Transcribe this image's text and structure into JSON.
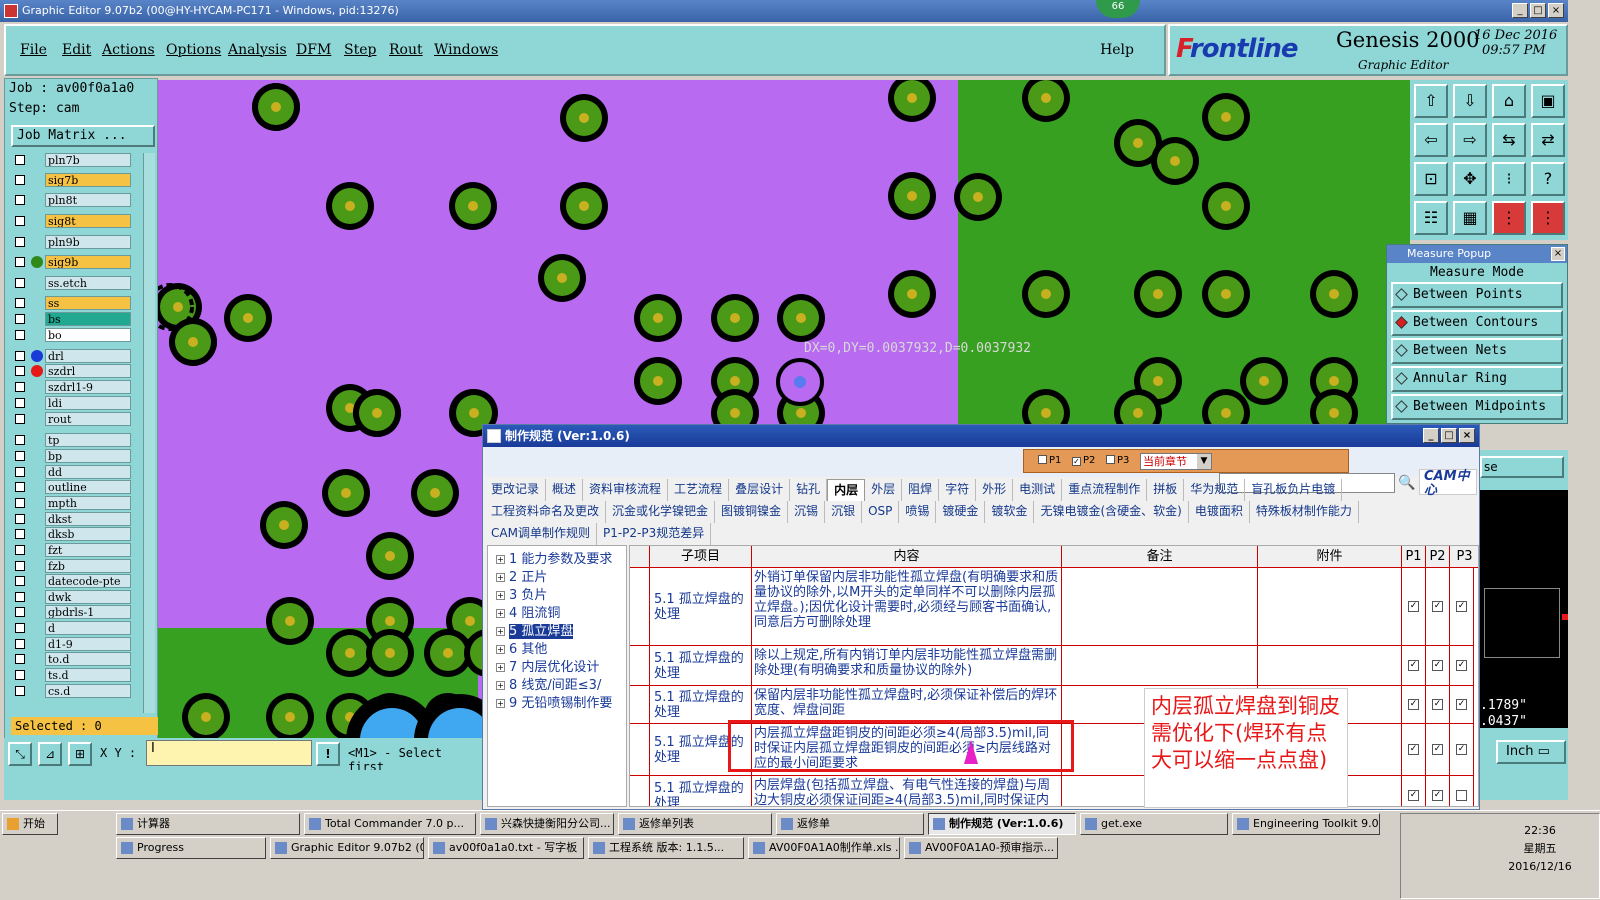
{
  "window": {
    "title": "Graphic Editor 9.07b2 (00@HY-HYCAM-PC171 - Windows, pid:13276)",
    "badge": "66"
  },
  "menu": {
    "items": [
      "File",
      "Edit",
      "Actions",
      "Options",
      "Analysis",
      "DFM",
      "Step",
      "Rout",
      "Windows"
    ],
    "help": "Help"
  },
  "logo": {
    "brand_f": "F",
    "brand_rest": "rontline",
    "product": "Genesis 2000",
    "subtitle": "Graphic Editor",
    "date": "16 Dec 2016",
    "time": "09:57 PM"
  },
  "job": {
    "job_line": "Job : av00f0a1a0",
    "step_line": "Step: cam",
    "matrix_btn": "Job Matrix ..."
  },
  "layers": [
    {
      "name": "pln7b",
      "style": "lightblue",
      "dot": ""
    },
    {
      "name": "sig7b",
      "style": "orange",
      "dot": ""
    },
    {
      "name": "pln8t",
      "style": "lightblue",
      "dot": ""
    },
    {
      "name": "sig8t",
      "style": "orange",
      "dot": ""
    },
    {
      "name": "pln9b",
      "style": "lightblue",
      "dot": ""
    },
    {
      "name": "sig9b",
      "style": "orange",
      "dot": "#2f8a1a"
    },
    {
      "name": "ss.etch",
      "style": "lightblue",
      "dot": ""
    },
    {
      "name": "ss",
      "style": "orange",
      "dot": ""
    },
    {
      "name": "bs",
      "style": "teal",
      "dot": ""
    },
    {
      "name": "bo",
      "style": "white",
      "dot": ""
    },
    {
      "name": "drl",
      "style": "lightblue",
      "dot": "#1a3ad8"
    },
    {
      "name": "szdrl",
      "style": "lightblue",
      "dot": "#e81818"
    },
    {
      "name": "szdrl1-9",
      "style": "lightblue",
      "dot": ""
    },
    {
      "name": "ldi",
      "style": "lightblue",
      "dot": ""
    },
    {
      "name": "rout",
      "style": "lightblue",
      "dot": ""
    },
    {
      "name": "tp",
      "style": "lightblue",
      "dot": ""
    },
    {
      "name": "bp",
      "style": "lightblue",
      "dot": ""
    },
    {
      "name": "dd",
      "style": "lightblue",
      "dot": ""
    },
    {
      "name": "outline",
      "style": "lightblue",
      "dot": ""
    },
    {
      "name": "mpth",
      "style": "lightblue",
      "dot": ""
    },
    {
      "name": "dkst",
      "style": "lightblue",
      "dot": ""
    },
    {
      "name": "dksb",
      "style": "lightblue",
      "dot": ""
    },
    {
      "name": "fzt",
      "style": "lightblue",
      "dot": ""
    },
    {
      "name": "fzb",
      "style": "lightblue",
      "dot": ""
    },
    {
      "name": "datecode-pte",
      "style": "lightblue",
      "dot": ""
    },
    {
      "name": "dwk",
      "style": "lightblue",
      "dot": ""
    },
    {
      "name": "gbdrls-1",
      "style": "lightblue",
      "dot": ""
    },
    {
      "name": "d",
      "style": "lightblue",
      "dot": ""
    },
    {
      "name": "d1-9",
      "style": "lightblue",
      "dot": ""
    },
    {
      "name": "to.d",
      "style": "lightblue",
      "dot": ""
    },
    {
      "name": "ts.d",
      "style": "lightblue",
      "dot": ""
    },
    {
      "name": "cs.d",
      "style": "lightblue",
      "dot": ""
    }
  ],
  "selected": "Selected : 0",
  "xy_label": "X Y :",
  "xy_value": "I",
  "prompt": "<M1> - Select first",
  "measure_text": "DX=0,DY=0.0037932,D=0.0037932",
  "measure_popup": {
    "title": "Measure Popup",
    "mode": "Measure Mode",
    "options": [
      {
        "label": "Between Points",
        "on": false
      },
      {
        "label": "Between Contours",
        "on": true
      },
      {
        "label": "Between Nets",
        "on": false
      },
      {
        "label": "Annular Ring",
        "on": false
      },
      {
        "label": "Between Midpoints",
        "on": false
      }
    ]
  },
  "right_readouts": {
    "v1": ".1789\"",
    "v2": ".0437\"",
    "unit": "Inch",
    "se": "se"
  },
  "dialog": {
    "title": "制作规范 (Ver:1.0.6)",
    "p1": "P1",
    "p2": "P2",
    "p3": "P3",
    "chapter": "当前章节",
    "cam_logo": "CAM中心",
    "tabs_row1": [
      "更改记录",
      "概述",
      "资料审核流程",
      "工艺流程",
      "叠层设计",
      "钻孔",
      "内层",
      "外层",
      "阻焊",
      "字符",
      "外形",
      "电测试",
      "重点流程制作",
      "拼板",
      "华为规范",
      "盲孔板负片电镀"
    ],
    "active_tab": "内层",
    "tabs_row2": [
      "工程资料命名及更改",
      "沉金或化学镍钯金",
      "图镀铜镍金",
      "沉锡",
      "沉银",
      "OSP",
      "喷锡",
      "镀硬金",
      "镀软金",
      "无镍电镀金(含硬金、软金)",
      "电镀面积",
      "特殊板材制作能力"
    ],
    "tabs_row3": [
      "CAM调单制作规则",
      "P1-P2-P3规范差异"
    ],
    "tree": [
      {
        "label": "1 能力参数及要求",
        "sel": false
      },
      {
        "label": "2 正片",
        "sel": false
      },
      {
        "label": "3 负片",
        "sel": false
      },
      {
        "label": "4 阻流铜",
        "sel": false
      },
      {
        "label": "5 孤立焊盘",
        "sel": true
      },
      {
        "label": "6 其他",
        "sel": false
      },
      {
        "label": "7 内层优化设计",
        "sel": false
      },
      {
        "label": "8 线宽/间距≤3/",
        "sel": false
      },
      {
        "label": "9 无铅喷锡制作要",
        "sel": false
      }
    ],
    "headers": [
      "子项目",
      "内容",
      "备注",
      "附件",
      "P1",
      "P2",
      "P3"
    ],
    "rows": [
      {
        "sub": "5.1 孤立焊盘的处理",
        "content": "外销订单保留内层非功能性孤立焊盘(有明确要求和质量协议的除外,以M开头的定单同样不可以删除内层孤立焊盘。);因优化设计需要时,必须经与顾客书面确认,同意后方可删除处理",
        "c": [
          true,
          true,
          true
        ]
      },
      {
        "sub": "5.1 孤立焊盘的处理",
        "content": "除以上规定,所有内销订单内层非功能性孤立焊盘需删除处理(有明确要求和质量协议的除外)",
        "c": [
          true,
          true,
          true
        ]
      },
      {
        "sub": "5.1 孤立焊盘的处理",
        "content": "保留内层非功能性孤立焊盘时,必须保证补偿后的焊环宽度、焊盘间距",
        "c": [
          true,
          true,
          true
        ]
      },
      {
        "sub": "5.1 孤立焊盘的处理",
        "content": "内层孤立焊盘距铜皮的间距必须≥4(局部3.5)mil,同时保证内层孤立焊盘距铜皮的间距必须≥内层线路对应的最小间距要求",
        "c": [
          true,
          true,
          true
        ]
      },
      {
        "sub": "5.1 孤立焊盘的处理",
        "content": "内层焊盘(包括孤立焊盘、有电气性连接的焊盘)与周边大铜皮必须保证间距≥4(局部3.5)mil,同时保证内层孤立焊盘距铜皮的间距",
        "c": [
          true,
          true,
          false
        ]
      }
    ]
  },
  "callout": "内层孤立焊盘到铜皮需优化下(焊环有点大可以缩一点点盘)",
  "taskbar": {
    "start": "开始",
    "row1": [
      {
        "label": "计算器",
        "active": false
      },
      {
        "label": "Total Commander 7.0 p...",
        "active": false
      },
      {
        "label": "兴森快捷衡阳分公司...",
        "active": false
      },
      {
        "label": "返修单列表",
        "active": false
      },
      {
        "label": "返修单",
        "active": false
      },
      {
        "label": "制作规范 (Ver:1.0.6)",
        "active": true
      },
      {
        "label": "get.exe",
        "active": false
      },
      {
        "label": "Engineering Toolkit 9.0...",
        "active": false
      }
    ],
    "row2": [
      {
        "label": "Progress",
        "active": false
      },
      {
        "label": "Graphic Editor 9.07b2 (0...",
        "active": false
      },
      {
        "label": "av00f0a1a0.txt - 写字板",
        "active": false
      },
      {
        "label": "工程系统  版本: 1.1.5...",
        "active": false
      },
      {
        "label": "AV00F0A1A0制作单.xls ...",
        "active": false
      },
      {
        "label": "AV00F0A1A0-预审指示...",
        "active": false
      }
    ],
    "clock_time": "22:36",
    "clock_day": "星期五",
    "clock_date": "2016/12/16"
  },
  "colors": {
    "accent": "#8fd6d6",
    "purple": "#b86af0",
    "green": "#38a020",
    "pad_outer": "#000000",
    "pad_ring": "#4a9a18",
    "pad_center": "#c8b020",
    "red": "#e81818"
  }
}
